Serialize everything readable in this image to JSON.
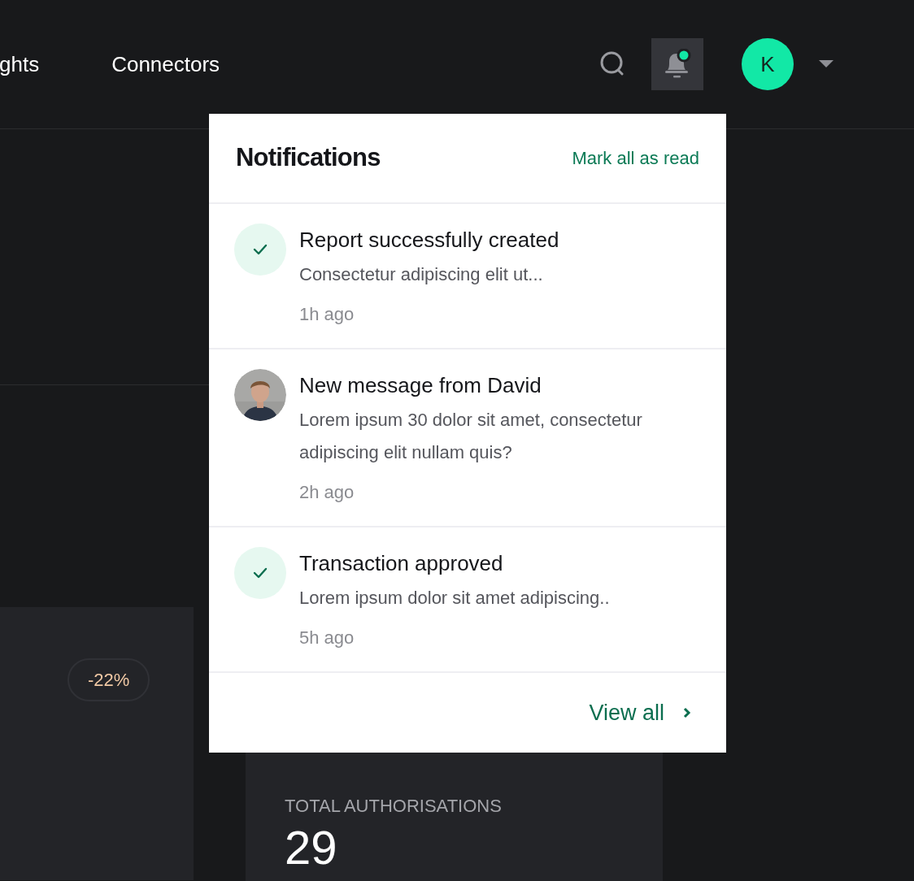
{
  "nav": [
    {
      "label": "ghts",
      "selected": false
    },
    {
      "label": "Connectors",
      "selected": false
    }
  ],
  "header": {
    "avatar_initial": "K",
    "bell_active": true,
    "bell_unread": true
  },
  "notifications": {
    "title": "Notifications",
    "mark_all": "Mark all as read",
    "items": [
      {
        "kind": "success",
        "title": "Report successfully created",
        "body": "Consectetur adipiscing elit ut...",
        "time": "1h ago"
      },
      {
        "kind": "message",
        "title": "New message from David",
        "body": "Lorem ipsum 30 dolor sit amet, consectetur adipiscing elit nullam quis?",
        "time": "2h ago"
      },
      {
        "kind": "success",
        "title": "Transaction approved",
        "body": "Lorem ipsum dolor sit amet adipiscing..",
        "time": "5h ago"
      }
    ],
    "view_all": "View all"
  },
  "cards": [
    {
      "badge": "-22%"
    },
    {
      "label": "TOTAL AUTHORISATIONS",
      "value": "29"
    }
  ]
}
